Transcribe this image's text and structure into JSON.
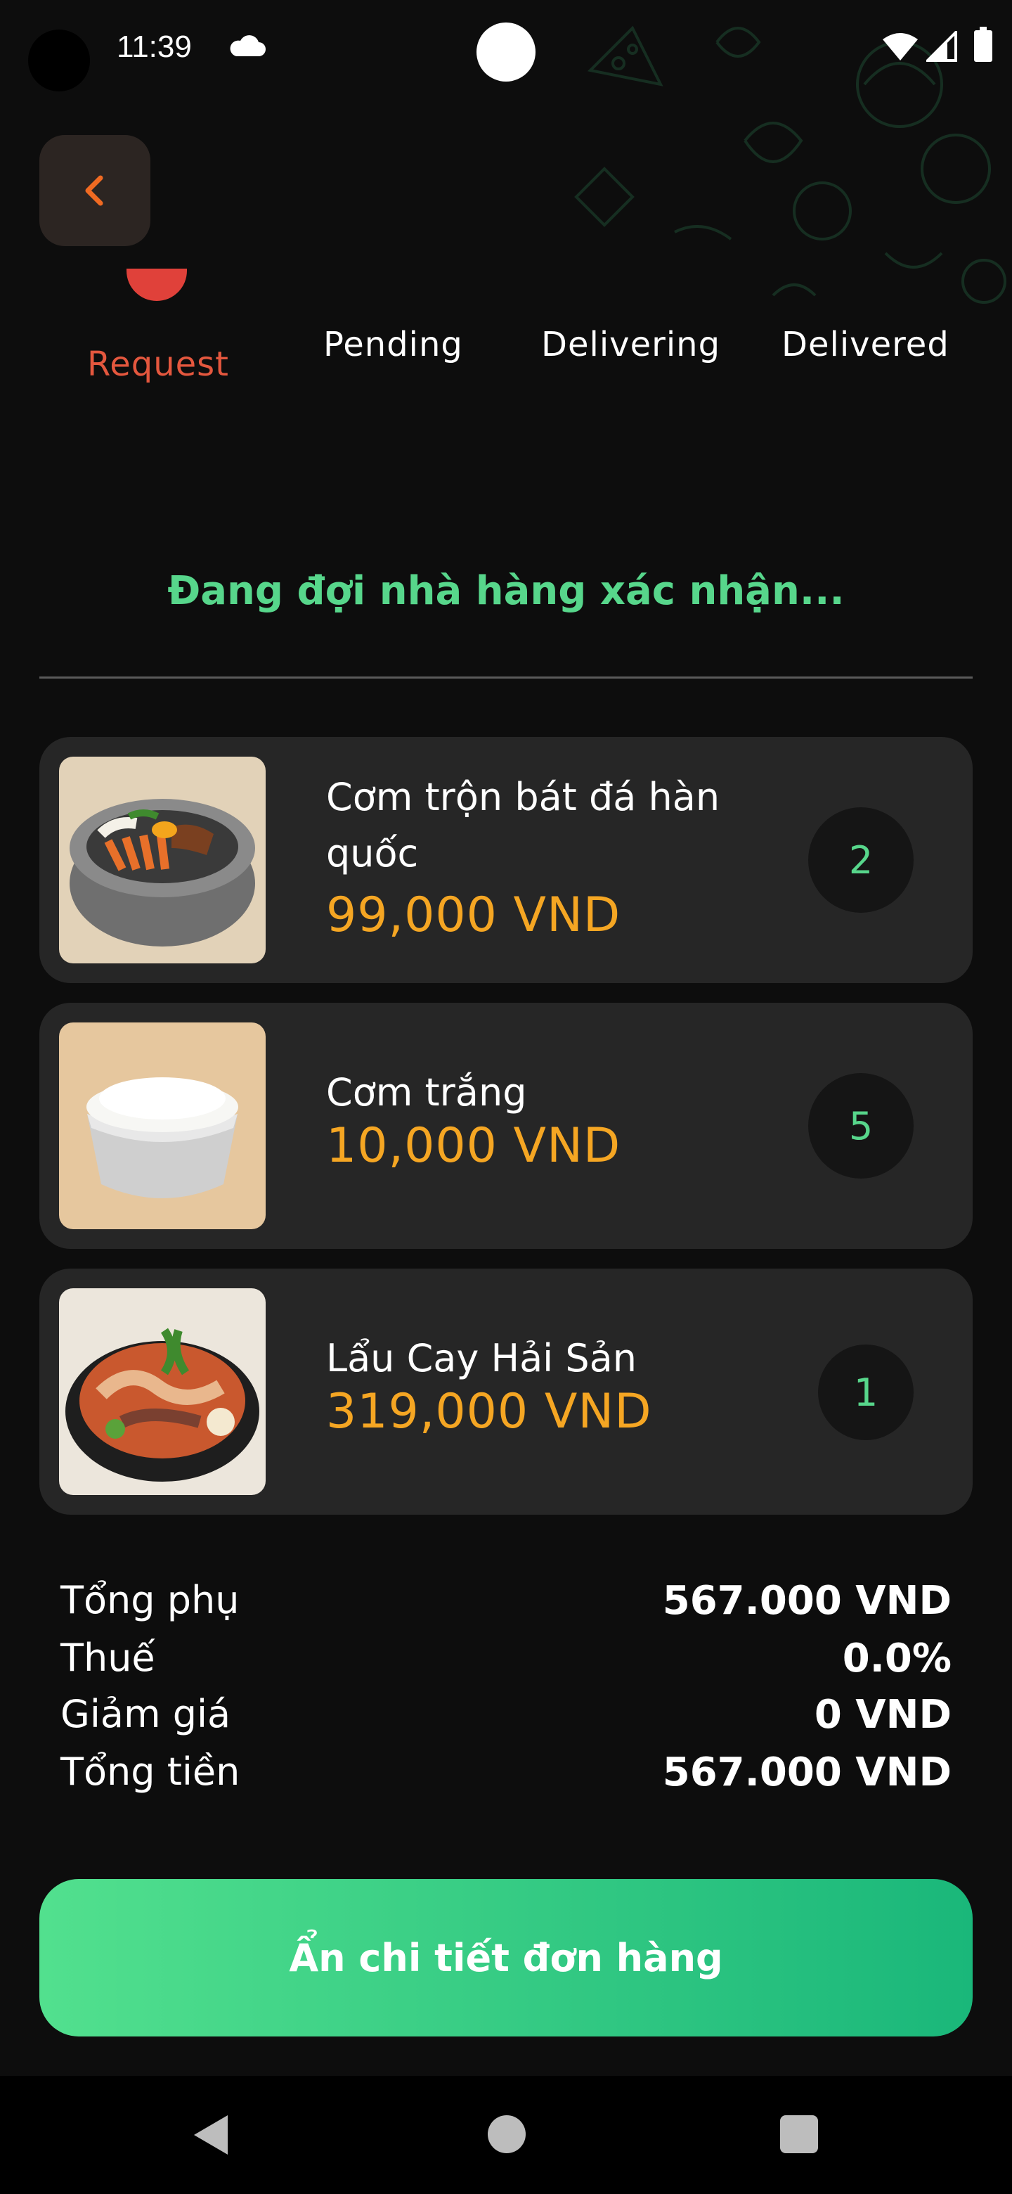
{
  "status_bar": {
    "time": "11:39"
  },
  "steps": {
    "request": "Request",
    "pending": "Pending",
    "delivering": "Delivering",
    "delivered": "Delivered"
  },
  "order_status_message": "Đang đợi nhà hàng xác nhận...",
  "items": [
    {
      "name": "Cơm trộn bát đá hàn quốc",
      "price": "99,000 VND",
      "quantity": "2"
    },
    {
      "name": "Cơm trắng",
      "price": "10,000 VND",
      "quantity": "5"
    },
    {
      "name": "Lẩu Cay Hải Sản",
      "price": "319,000 VND",
      "quantity": "1"
    }
  ],
  "summary": {
    "subtotal_label": "Tổng phụ",
    "subtotal_value": "567.000 VND",
    "tax_label": "Thuế",
    "tax_value": "0.0%",
    "discount_label": "Giảm giá",
    "discount_value": "0 VND",
    "total_label": "Tổng tiền",
    "total_value": "567.000 VND"
  },
  "hide_details_button": "Ẩn chi tiết đơn hàng",
  "colors": {
    "background": "#0d0d0d",
    "card": "#262626",
    "accent_green": "#57d68b",
    "price_orange": "#f5a623",
    "active_step": "#e4573e"
  },
  "icons": {
    "back": "chevron-left-icon",
    "cloud": "cloud-icon",
    "wifi": "wifi-icon",
    "signal": "signal-icon",
    "battery": "battery-icon"
  }
}
